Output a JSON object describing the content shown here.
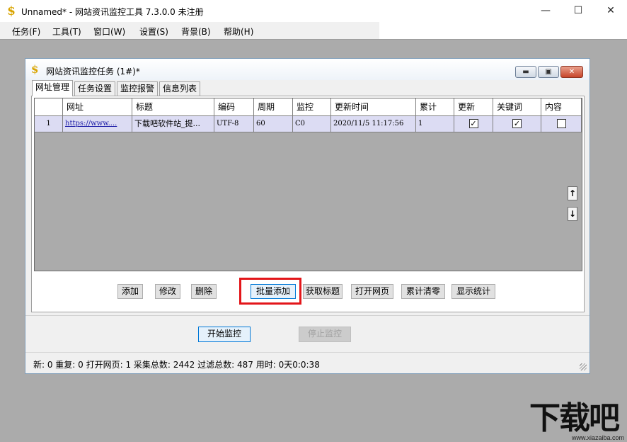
{
  "window": {
    "title": "Unnamed* - 网站资讯监控工具 7.3.0.0  未注册",
    "minimize": "—",
    "maximize": "☐",
    "close": "✕"
  },
  "menu": [
    {
      "label": "任务(F)"
    },
    {
      "label": "工具(T)"
    },
    {
      "label": "窗口(W)"
    },
    {
      "label": "设置(S)"
    },
    {
      "label": "背景(B)"
    },
    {
      "label": "帮助(H)"
    }
  ],
  "child": {
    "title": "网站资讯监控任务  (1#)*"
  },
  "tabs": [
    {
      "label": "网址管理",
      "active": true
    },
    {
      "label": "任务设置"
    },
    {
      "label": "监控报警"
    },
    {
      "label": "信息列表"
    }
  ],
  "table": {
    "headers": [
      "",
      "网址",
      "标题",
      "编码",
      "周期",
      "监控",
      "更新时间",
      "累计",
      "更新",
      "关键词",
      "内容"
    ],
    "rows": [
      {
        "num": "1",
        "url": "https://www....",
        "title": "下载吧软件站_提...",
        "encoding": "UTF-8",
        "period": "60",
        "monitor": "C0",
        "updated": "2020/11/5 11:17:56",
        "total": "1",
        "update_checked": "✓",
        "keyword_checked": "✓",
        "content_checked": ""
      }
    ]
  },
  "scroll": {
    "up": "↑",
    "down": "↓"
  },
  "actions": {
    "add": "添加",
    "edit": "修改",
    "delete": "删除",
    "batch_add": "批量添加",
    "get_title": "获取标题",
    "open_page": "打开网页",
    "clear_total": "累计清零",
    "show_stats": "显示统计"
  },
  "controls": {
    "start": "开始监控",
    "stop": "停止监控"
  },
  "status": "新:  0   重复:  0   打开网页:  1   采集总数:  2442   过滤总数:  487   用时:  0天0:0:38",
  "colors": {
    "highlight": "#e3161a",
    "accent": "#0078d7"
  },
  "watermark": {
    "main": "下载吧",
    "url": "www.xiazaiba.com"
  }
}
